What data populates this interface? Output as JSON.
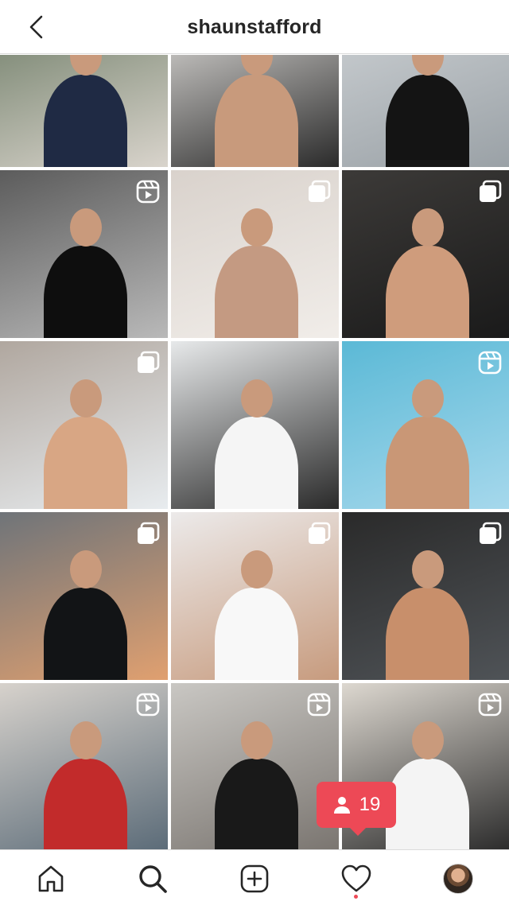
{
  "header": {
    "username": "shaunstafford",
    "back_icon": "chevron-left-icon"
  },
  "grid": {
    "posts": [
      {
        "badge": "none",
        "colors": [
          "#6b7a64",
          "#1f2a44",
          "#d9d4cc"
        ]
      },
      {
        "badge": "none",
        "colors": [
          "#e9e7e4",
          "#c89a7c",
          "#2b2b2b"
        ]
      },
      {
        "badge": "none",
        "colors": [
          "#cfd3d6",
          "#141414",
          "#9aa1a6"
        ]
      },
      {
        "badge": "reel",
        "colors": [
          "#5c5c5c",
          "#0e0e0e",
          "#b9b9b9"
        ]
      },
      {
        "badge": "carousel",
        "colors": [
          "#d9d2cc",
          "#c49a82",
          "#f1ede9"
        ]
      },
      {
        "badge": "carousel",
        "colors": [
          "#3c3a38",
          "#cf9c7c",
          "#1a1a1a"
        ]
      },
      {
        "badge": "carousel",
        "colors": [
          "#b0a79f",
          "#d8a684",
          "#e8ecef"
        ]
      },
      {
        "badge": "none",
        "colors": [
          "#e7e9ea",
          "#f5f5f5",
          "#2a2a2a"
        ]
      },
      {
        "badge": "reel",
        "colors": [
          "#5bb9d6",
          "#c99776",
          "#a6d8ec"
        ]
      },
      {
        "badge": "carousel",
        "colors": [
          "#6f7479",
          "#121416",
          "#e0a070"
        ]
      },
      {
        "badge": "carousel",
        "colors": [
          "#eceaea",
          "#f8f8f8",
          "#c79b7e"
        ]
      },
      {
        "badge": "carousel",
        "colors": [
          "#2a2a2a",
          "#c88f6b",
          "#4f5357"
        ]
      },
      {
        "badge": "reel",
        "colors": [
          "#d7d2cc",
          "#c22b2b",
          "#5b6b78"
        ]
      },
      {
        "badge": "reel",
        "colors": [
          "#c9c7c3",
          "#191919",
          "#7a7570"
        ]
      },
      {
        "badge": "reel",
        "colors": [
          "#ddd8d0",
          "#f4f4f4",
          "#2b2b2b"
        ]
      }
    ]
  },
  "notification": {
    "icon": "person-icon",
    "count": "19"
  },
  "tabbar": {
    "items": [
      "home-icon",
      "search-icon",
      "new-post-icon",
      "activity-heart-icon",
      "profile-avatar"
    ],
    "accent": "#ed4956"
  }
}
